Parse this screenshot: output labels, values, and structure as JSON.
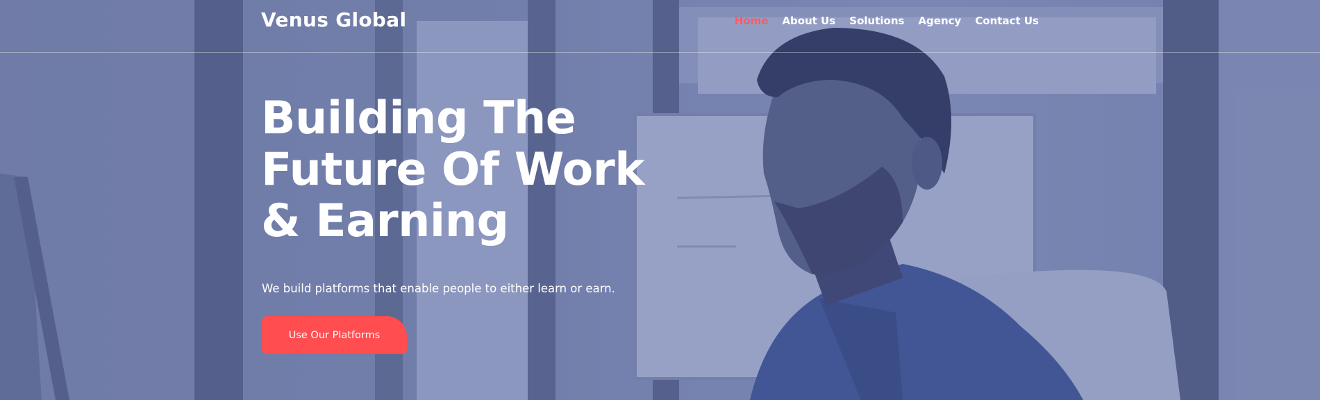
{
  "brand": {
    "name": "Venus Global"
  },
  "nav": {
    "items": [
      {
        "label": "Home",
        "active": true
      },
      {
        "label": "About Us",
        "active": false
      },
      {
        "label": "Solutions",
        "active": false
      },
      {
        "label": "Agency",
        "active": false
      },
      {
        "label": "Contact Us",
        "active": false
      }
    ]
  },
  "hero": {
    "headline_lines": [
      "Building The",
      "Future Of Work",
      "& Earning"
    ],
    "subtitle": "We build platforms that enable people to either learn or earn.",
    "cta_label": "Use Our Platforms",
    "background_image": "office-man-photo"
  },
  "colors": {
    "accent": "#ff4d50",
    "nav_active": "#ff5a5f",
    "overlay": "#4856a0",
    "text": "#ffffff"
  }
}
